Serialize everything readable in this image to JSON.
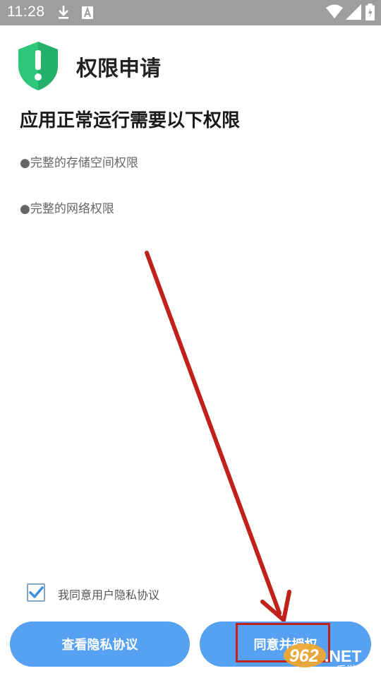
{
  "status_bar": {
    "time": "11:28",
    "icons": [
      "download-icon",
      "font-icon",
      "wifi-icon",
      "signal-icon",
      "battery-icon"
    ]
  },
  "app": {
    "title": "权限申请",
    "icon": "shield-alert-icon",
    "accent_color": "#2ec77a"
  },
  "heading": "应用正常运行需要以下权限",
  "permissions": [
    {
      "label": "●完整的存储空间权限"
    },
    {
      "label": "●完整的网络权限"
    }
  ],
  "agreement": {
    "checked": true,
    "label": "我同意用户隐私协议"
  },
  "buttons": {
    "view_privacy": "查看隐私协议",
    "agree_authorize": "同意并授权",
    "color": "#56a1f2"
  },
  "annotation": {
    "arrow_color": "#c0211b"
  },
  "watermark": {
    "brand": "962.NET",
    "subtitle": "乐游网"
  }
}
